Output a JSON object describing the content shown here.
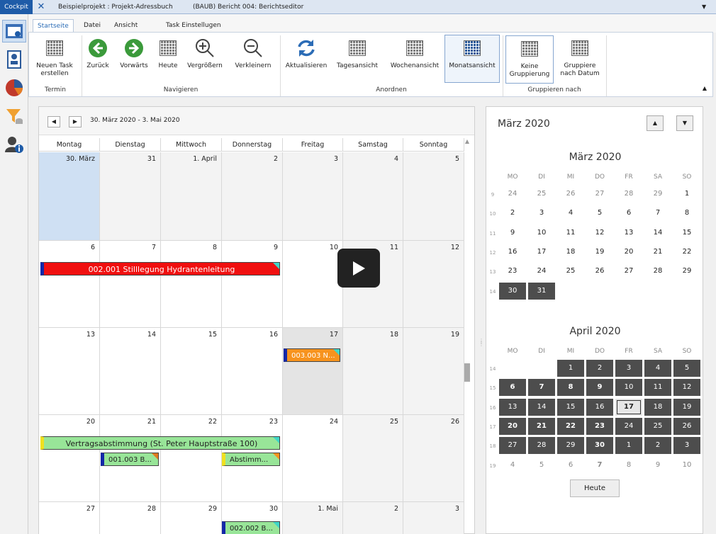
{
  "tabs": [
    "Cockpit",
    "Beispielprojekt : Projekt-Adressbuch",
    "(BAUB) Bericht 004: Berichtseditor"
  ],
  "ribbon_tabs": [
    "Startseite",
    "Datei",
    "Ansicht",
    "Task Einstellugen"
  ],
  "ribbon": {
    "new_task": "Neuen Task erstellen",
    "back": "Zurück",
    "forward": "Vorwärts",
    "today": "Heute",
    "zoom_in": "Vergrößern",
    "zoom_out": "Verkleinern",
    "refresh": "Aktualisieren",
    "day_view": "Tagesansicht",
    "week_view": "Wochenansicht",
    "month_view": "Monatsansicht",
    "no_group": "Keine Gruppierung",
    "group_date": "Gruppiere nach Datum",
    "group_termin": "Termin",
    "group_navigieren": "Navigieren",
    "group_anordnen": "Anordnen",
    "group_gruppieren": "Gruppieren nach"
  },
  "calendar": {
    "range": "30. März 2020 - 3. Mai 2020",
    "days": [
      "Montag",
      "Dienstag",
      "Mittwoch",
      "Donnerstag",
      "Freitag",
      "Samstag",
      "Sonntag"
    ],
    "weeks": [
      [
        "30. März",
        "31",
        "1. April",
        "2",
        "3",
        "4",
        "5"
      ],
      [
        "6",
        "7",
        "8",
        "9",
        "10",
        "11",
        "12"
      ],
      [
        "13",
        "14",
        "15",
        "16",
        "17",
        "18",
        "19"
      ],
      [
        "20",
        "21",
        "22",
        "23",
        "24",
        "25",
        "26"
      ],
      [
        "27",
        "28",
        "29",
        "30",
        "1. Mai",
        "2",
        "3"
      ]
    ],
    "events": [
      {
        "text": "002.001 Stilllegung Hydrantenleitung",
        "color": "#f01010"
      },
      {
        "text": "003.003 N...",
        "color": "#f7931e"
      },
      {
        "text": "Vertragsabstimmung (St. Peter Hauptstraße 100)",
        "color": "#98e598"
      },
      {
        "text": "001.003 B...",
        "color": "#98e598"
      },
      {
        "text": "Abstimm...",
        "color": "#98e598"
      },
      {
        "text": "002.002 B...",
        "color": "#98e598"
      }
    ]
  },
  "side": {
    "title": "März 2020",
    "month1": "März 2020",
    "month2": "April 2020",
    "dow": [
      "MO",
      "DI",
      "MI",
      "DO",
      "FR",
      "SA",
      "SO"
    ],
    "m1weeks": [
      "9",
      "10",
      "11",
      "12",
      "13",
      "14"
    ],
    "m2weeks": [
      "14",
      "15",
      "16",
      "17",
      "18",
      "19"
    ],
    "today_button": "Heute"
  }
}
